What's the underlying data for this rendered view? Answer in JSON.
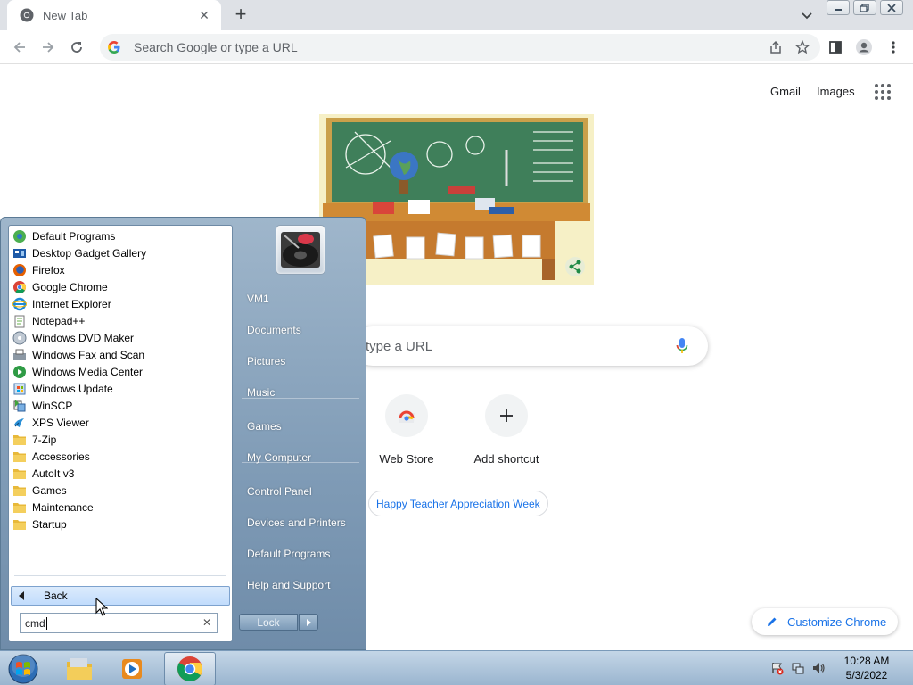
{
  "browser": {
    "tab_title": "New Tab",
    "omnibox_placeholder": "Search Google or type a URL"
  },
  "ntp": {
    "gmail": "Gmail",
    "images": "Images",
    "search_placeholder": "type a URL",
    "shortcuts": [
      {
        "label": "Web Store",
        "icon": "web-store-icon"
      },
      {
        "label": "Add shortcut",
        "icon": "plus-icon"
      }
    ],
    "doodle_chip": "Happy Teacher Appreciation Week",
    "customize": "Customize Chrome"
  },
  "startmenu": {
    "programs": [
      {
        "label": "Default Programs",
        "icon": "default-programs-icon"
      },
      {
        "label": "Desktop Gadget Gallery",
        "icon": "gadget-gallery-icon"
      },
      {
        "label": "Firefox",
        "icon": "firefox-icon"
      },
      {
        "label": "Google Chrome",
        "icon": "chrome-icon"
      },
      {
        "label": "Internet Explorer",
        "icon": "internet-explorer-icon"
      },
      {
        "label": "Notepad++",
        "icon": "notepadpp-icon"
      },
      {
        "label": "Windows DVD Maker",
        "icon": "dvd-maker-icon"
      },
      {
        "label": "Windows Fax and Scan",
        "icon": "fax-scan-icon"
      },
      {
        "label": "Windows Media Center",
        "icon": "media-center-icon"
      },
      {
        "label": "Windows Update",
        "icon": "windows-update-icon"
      },
      {
        "label": "WinSCP",
        "icon": "winscp-icon"
      },
      {
        "label": "XPS Viewer",
        "icon": "xps-viewer-icon"
      },
      {
        "label": "7-Zip",
        "icon": "folder-icon"
      },
      {
        "label": "Accessories",
        "icon": "folder-icon"
      },
      {
        "label": "AutoIt v3",
        "icon": "folder-icon"
      },
      {
        "label": "Games",
        "icon": "folder-icon"
      },
      {
        "label": "Maintenance",
        "icon": "folder-icon"
      },
      {
        "label": "Startup",
        "icon": "folder-icon"
      }
    ],
    "back": "Back",
    "search_value": "cmd",
    "right_items": [
      "VM1",
      "Documents",
      "Pictures",
      "Music",
      "Games",
      "My Computer",
      "Control Panel",
      "Devices and Printers",
      "Default Programs",
      "Help and Support"
    ],
    "lock": "Lock"
  },
  "taskbar": {
    "time": "10:28 AM",
    "date": "5/3/2022"
  },
  "colors": {
    "link_blue": "#1a73e8",
    "folder_yellow": "#e8b93a"
  }
}
